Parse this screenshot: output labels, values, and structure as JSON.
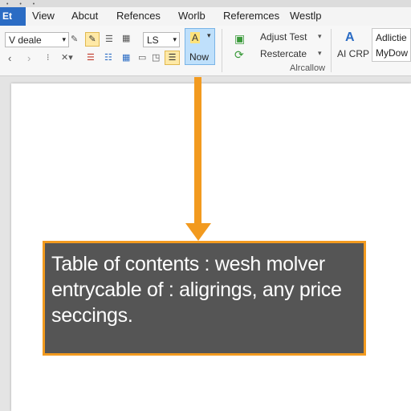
{
  "menu": {
    "active": "Et",
    "items": [
      "View",
      "Abcut",
      "Refences",
      "Worlb",
      "Referemces",
      "Westlp"
    ]
  },
  "ribbon": {
    "style_box": "V deale",
    "size_box": "LS",
    "now_label": "Now",
    "adjust_label": "Adjust Test",
    "restart_label": "Restercate",
    "group_label": "Alrcallow",
    "ai_label": "AI CRP",
    "style_preview_1": "Adlictie",
    "style_preview_2": "MyDow"
  },
  "callout": {
    "text": "Table of contents : wesh molver entrycable of : aligrings,  any price seccings."
  },
  "colors": {
    "accent": "#f29a1f",
    "active_tab": "#2b6cc4",
    "callout_bg": "#555555"
  }
}
